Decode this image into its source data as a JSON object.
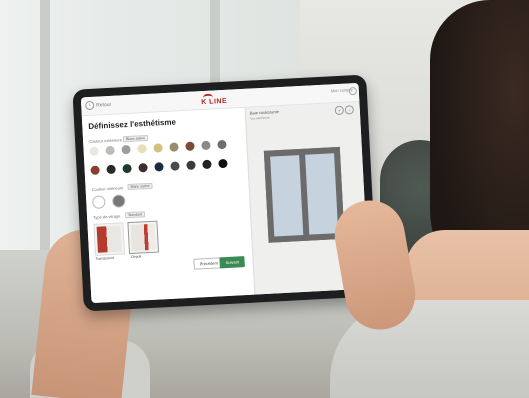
{
  "tablet": {
    "topbar": {
      "back_label": "Retour",
      "account_label": "Mon compte"
    },
    "logo": {
      "brand": "K LINE"
    },
    "left_panel": {
      "title": "Définissez l'esthétisme",
      "exterior_label": "Couleur extérieure",
      "exterior_chip": "Blanc satiné",
      "interior_label": "Couleur intérieure",
      "interior_chip": "Blanc satiné",
      "handle_label": "Type de vitrage",
      "handle_chip": "Standard",
      "tiles": [
        {
          "caption": "Transparent"
        },
        {
          "caption": "Dépoli"
        }
      ],
      "prev_label": "Précédent",
      "next_label": "Suivant"
    },
    "right_panel": {
      "title": "Baie coulissante",
      "subtitle": "Vue extérieure"
    },
    "colors": {
      "row1": [
        "#e8e8e6",
        "#bdbdb5",
        "#9e9e98",
        "#e8dfb8",
        "#d4c07a",
        "#9b8a6c",
        "#7b4a3a",
        "#8a8a85",
        "#6e6e6a"
      ],
      "row2": [
        "#8a3e2e",
        "#2a2a2a",
        "#1d3b2c",
        "#3b2e2e",
        "#1c2a44",
        "#4a4a4a",
        "#3b3b3b",
        "#222222",
        "#111111"
      ],
      "interior": [
        "#ffffff",
        "#777775"
      ],
      "accent": "#3b8a55",
      "brand": "#b32226",
      "frame": "#6b6b6b",
      "glass": "#c6d2dd"
    }
  }
}
